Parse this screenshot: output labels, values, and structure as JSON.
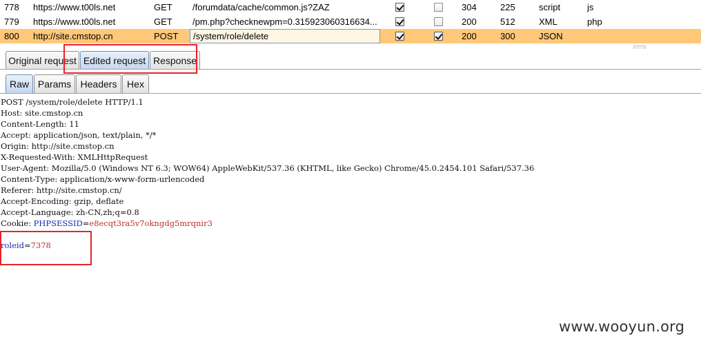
{
  "history": {
    "rows": [
      {
        "num": "778",
        "host": "https://www.t00ls.net",
        "method": "GET",
        "url": "/forumdata/cache/common.js?ZAZ",
        "edited": true,
        "response": false,
        "status": "304",
        "length": "225",
        "mime": "script",
        "ext": "js",
        "selected": false
      },
      {
        "num": "779",
        "host": "https://www.t00ls.net",
        "method": "GET",
        "url": "/pm.php?checknewpm=0.315923060316634...",
        "edited": true,
        "response": false,
        "status": "200",
        "length": "512",
        "mime": "XML",
        "ext": "php",
        "selected": false
      },
      {
        "num": "800",
        "host": "http://site.cmstop.cn",
        "method": "POST",
        "url": "/system/role/delete",
        "edited": true,
        "response": true,
        "status": "200",
        "length": "300",
        "mime": "JSON",
        "ext": "",
        "selected": true
      }
    ]
  },
  "main_tabs": {
    "original": "Original request",
    "edited": "Edited request",
    "response": "Response"
  },
  "sub_tabs": {
    "raw": "Raw",
    "params": "Params",
    "headers": "Headers",
    "hex": "Hex"
  },
  "request": {
    "lines": [
      "POST /system/role/delete HTTP/1.1",
      "Host: site.cmstop.cn",
      "Content-Length: 11",
      "Accept: application/json, text/plain, */*",
      "Origin: http://site.cmstop.cn",
      "X-Requested-With: XMLHttpRequest",
      "User-Agent: Mozilla/5.0 (Windows NT 6.3; WOW64) AppleWebKit/537.36 (KHTML, like Gecko) Chrome/45.0.2454.101 Safari/537.36",
      "Content-Type: application/x-www-form-urlencoded",
      "Referer: http://site.cmstop.cn/",
      "Accept-Encoding: gzip, deflate",
      "Accept-Language: zh-CN,zh;q=0.8"
    ],
    "cookie_label": "Cookie: ",
    "cookie_key": "PHPSESSID",
    "cookie_eq": "=",
    "cookie_value": "e8ecqt3ra5v7okngdg5mrqnir3",
    "body_key": "roleid",
    "body_eq": "=",
    "body_value": "7378"
  },
  "watermark": "www.wooyun.org",
  "colors": {
    "selected_row": "#ffc878",
    "highlight_box": "#e8222a",
    "param_key": "#1a2bb0",
    "param_value": "#b8322a"
  }
}
